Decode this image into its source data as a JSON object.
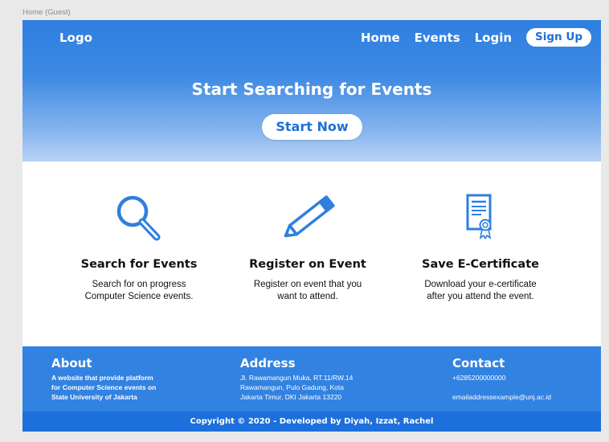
{
  "frame_label": "Home (Guest)",
  "header": {
    "logo": "Logo",
    "nav": {
      "home": "Home",
      "events": "Events",
      "login": "Login",
      "signup": "Sign Up"
    }
  },
  "hero": {
    "title": "Start Searching for Events",
    "button": "Start Now"
  },
  "features": [
    {
      "title": "Search for Events",
      "line1": "Search for on progress",
      "line2": "Computer Science events.",
      "icon": "magnifier-icon"
    },
    {
      "title": "Register on Event",
      "line1": "Register on event that you",
      "line2": "want to attend.",
      "icon": "pencil-icon"
    },
    {
      "title": "Save E-Certificate",
      "line1": "Download your e-certificate",
      "line2": "after you attend the event.",
      "icon": "certificate-icon"
    }
  ],
  "footer": {
    "about": {
      "heading": "About",
      "line1": "A website that provide platform",
      "line2": "for Computer Science events on",
      "line3": "State University of Jakarta"
    },
    "address": {
      "heading": "Address",
      "line1": "Jl. Rawamangun Muka, RT.11/RW.14",
      "line2": "Rawamangun, Pulo Gadung, Kota",
      "line3": "Jakarta Timur, DKI Jakarta 13220"
    },
    "contact": {
      "heading": "Contact",
      "phone": "+6285200000000",
      "email": "emailaddressexample@unj.ac.id"
    },
    "copyright": "Copyright © 2020 - Developed by Diyah, Izzat, Rachel"
  },
  "colors": {
    "primary": "#3282e1",
    "copyright_bar": "#1d6fdb",
    "accent_text": "#1f6fd6",
    "icon": "#2f7fdf"
  }
}
